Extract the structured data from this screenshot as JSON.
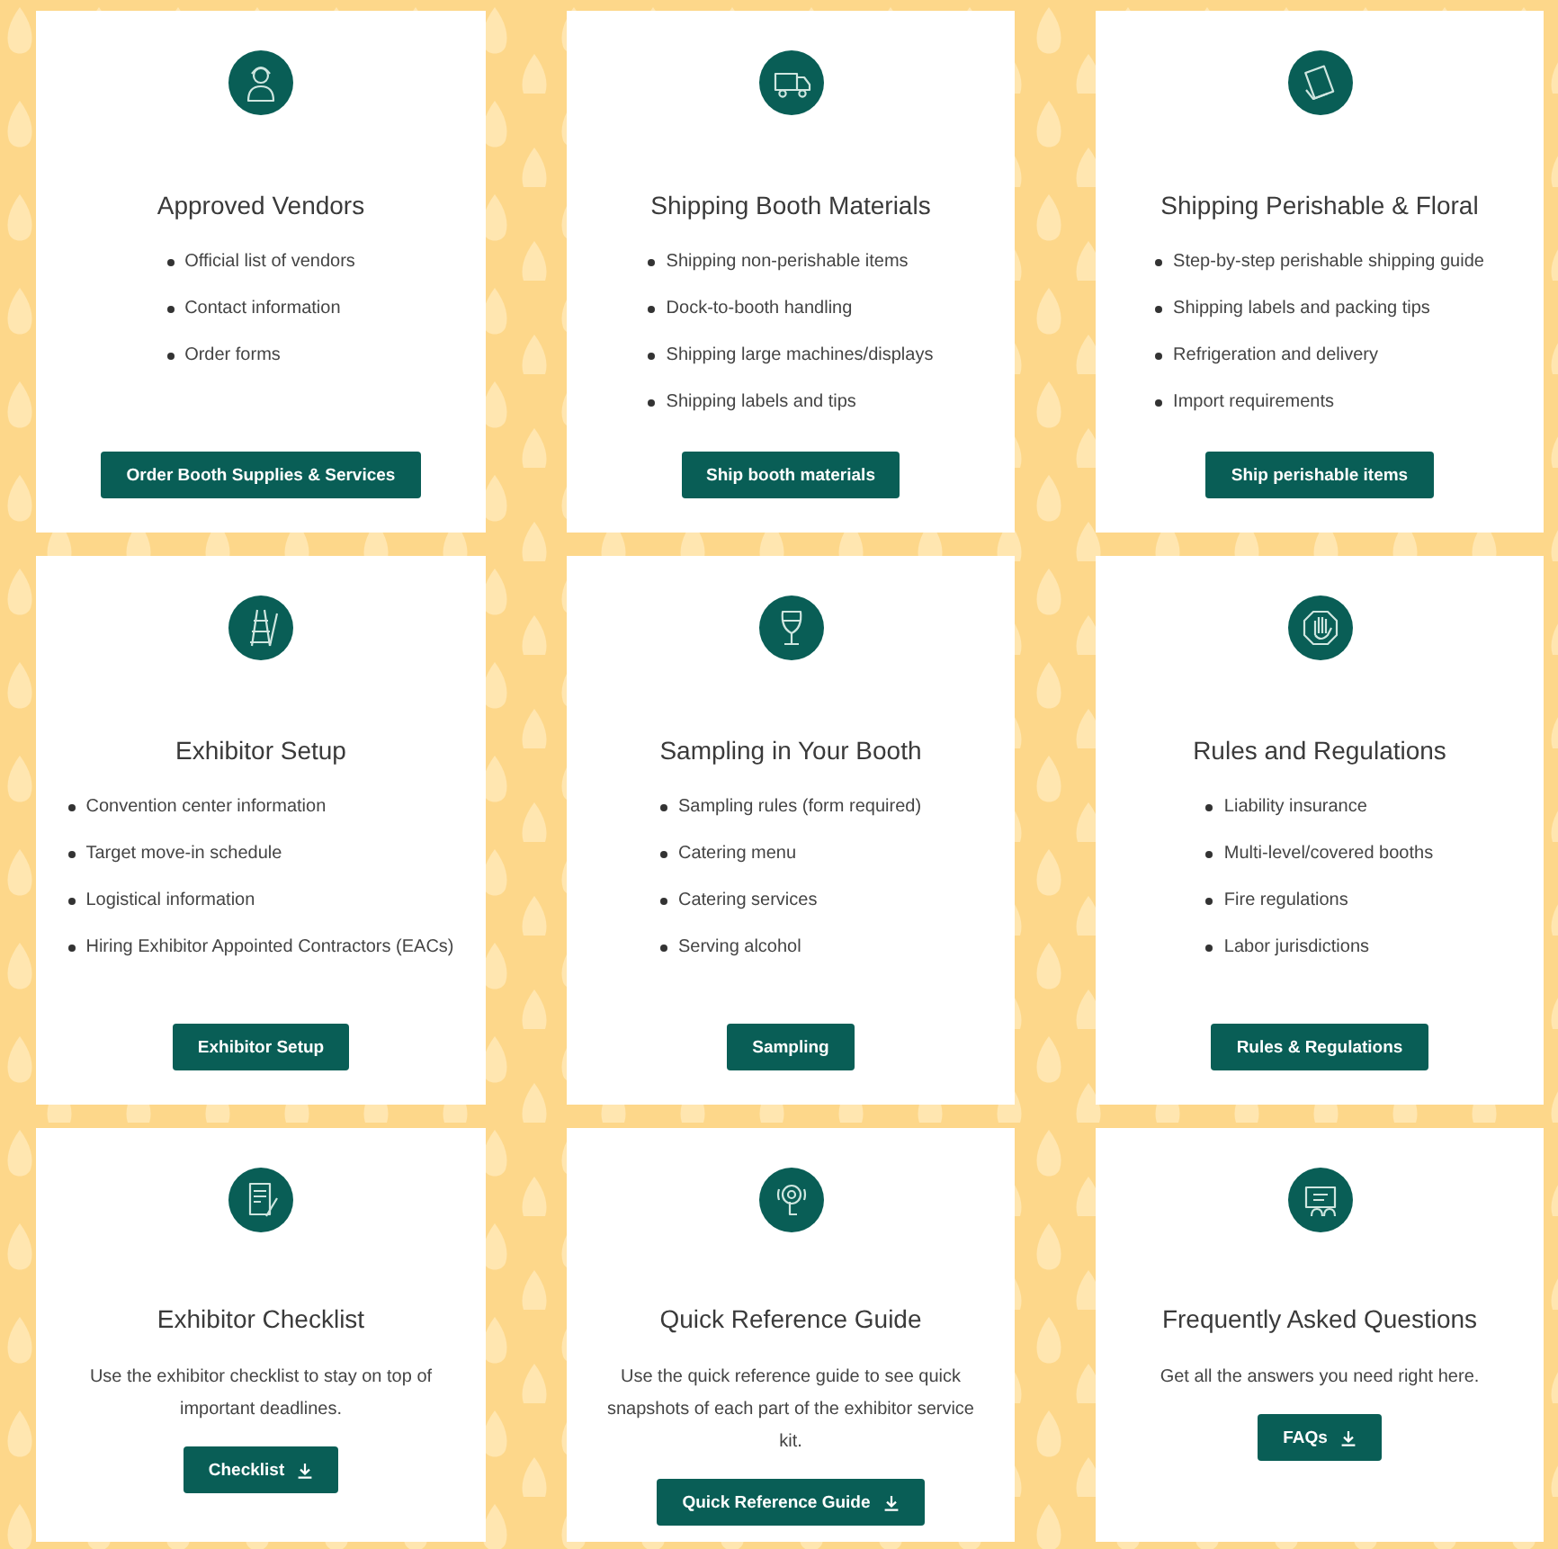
{
  "cards": [
    {
      "title": "Approved Vendors",
      "kind": "list",
      "items": [
        "Official list of vendors",
        "Contact information",
        "Order forms"
      ],
      "button": {
        "label": "Order Booth Supplies & Services",
        "download": false
      }
    },
    {
      "title": "Shipping Booth Materials",
      "kind": "list",
      "items": [
        "Shipping non-perishable items",
        "Dock-to-booth handling",
        "Shipping large machines/displays",
        "Shipping labels and tips"
      ],
      "button": {
        "label": "Ship booth materials",
        "download": false
      }
    },
    {
      "title": "Shipping Perishable & Floral",
      "kind": "list",
      "items": [
        "Step-by-step perishable shipping guide",
        "Shipping labels and packing tips",
        "Refrigeration and delivery",
        "Import requirements"
      ],
      "button": {
        "label": "Ship perishable items",
        "download": false
      }
    },
    {
      "title": "Exhibitor Setup",
      "kind": "list",
      "items": [
        "Convention center information",
        "Target move-in schedule",
        "Logistical information",
        "Hiring Exhibitor Appointed Contractors (EACs)"
      ],
      "button": {
        "label": "Exhibitor Setup",
        "download": false
      }
    },
    {
      "title": "Sampling in Your Booth",
      "kind": "list",
      "items": [
        "Sampling rules (form required)",
        "Catering menu",
        "Catering services",
        "Serving alcohol"
      ],
      "button": {
        "label": "Sampling",
        "download": false
      }
    },
    {
      "title": "Rules and Regulations",
      "kind": "list",
      "items": [
        "Liability insurance",
        "Multi-level/covered booths",
        "Fire regulations",
        "Labor jurisdictions"
      ],
      "button": {
        "label": "Rules & Regulations",
        "download": false
      }
    },
    {
      "title": "Exhibitor Checklist",
      "kind": "text",
      "text": "Use the exhibitor checklist to stay on top of important deadlines.",
      "button": {
        "label": "Checklist",
        "download": true
      }
    },
    {
      "title": "Quick Reference Guide",
      "kind": "text",
      "text": "Use the quick reference guide to see quick snapshots of each part of the exhibitor service kit.",
      "button": {
        "label": "Quick Reference Guide",
        "download": true
      }
    },
    {
      "title": "Frequently Asked Questions",
      "kind": "text",
      "text": "Get all the answers you need right here.",
      "button": {
        "label": "FAQs",
        "download": true
      }
    }
  ]
}
